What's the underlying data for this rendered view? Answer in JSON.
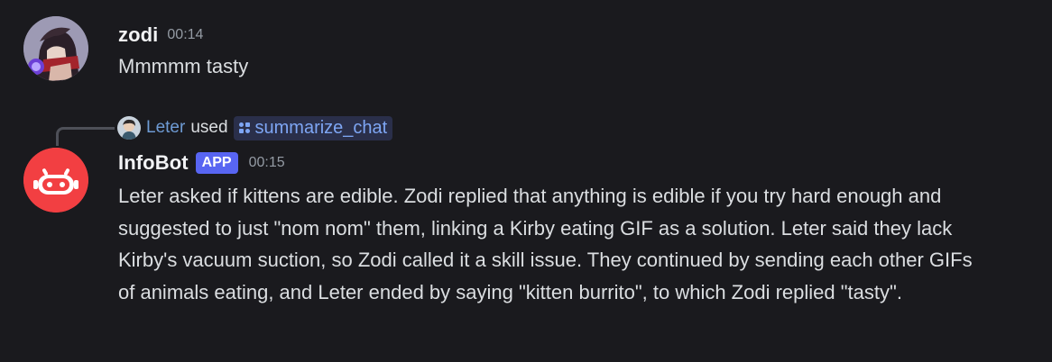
{
  "messages": [
    {
      "author": "zodi",
      "time": "00:14",
      "text": "Mmmmm tasty"
    },
    {
      "author": "InfoBot",
      "badge": "APP",
      "time": "00:15",
      "reply": {
        "user": "Leter",
        "used": "used",
        "command": "summarize_chat"
      },
      "text": "Leter asked if kittens are edible. Zodi replied that anything is edible if you try hard enough and suggested to just \"nom nom\" them, linking a Kirby eating GIF as a solution. Leter said they lack Kirby's vacuum suction, so Zodi called it a skill issue. They continued by sending each other GIFs of animals eating, and Leter ended by saying \"kitten burrito\", to which Zodi replied \"tasty\"."
    }
  ],
  "colors": {
    "background": "#1a1a1e",
    "app_badge": "#5865f2",
    "bot_avatar": "#f23f42",
    "command_text": "#7ea6f4",
    "reply_user": "#6e9bd4"
  },
  "icons": {
    "bot_avatar": "robot-icon",
    "command": "app-command-icon"
  }
}
